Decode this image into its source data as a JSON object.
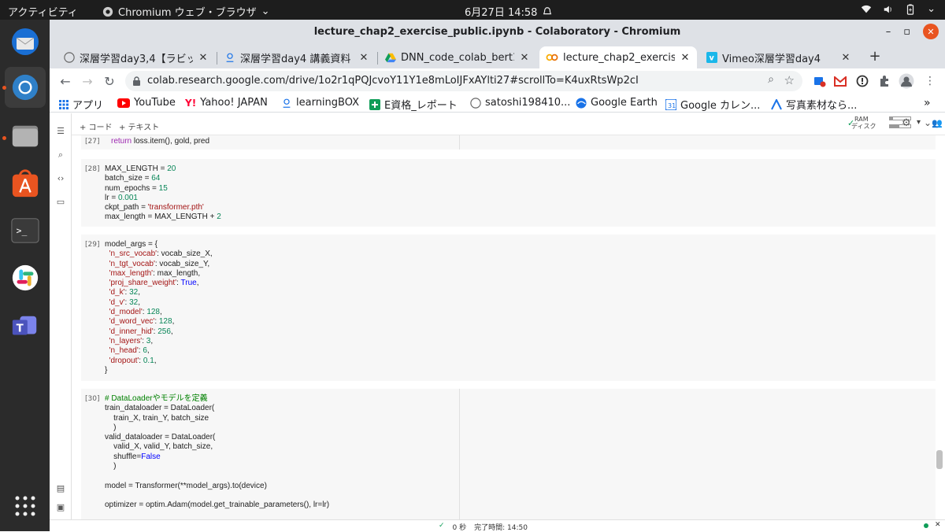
{
  "topbar": {
    "activities": "アクティビティ",
    "app_name": "Chromium ウェブ・ブラウザ",
    "datetime": "6月27日  14:58"
  },
  "dock": {
    "items": [
      "thunderbird",
      "chromium",
      "files",
      "software",
      "terminal",
      "slack",
      "teams",
      "app-grid"
    ]
  },
  "window": {
    "title": "lecture_chap2_exercise_public.ipynb - Colaboratory - Chromium"
  },
  "tabs": [
    {
      "label": "深層学習day3,4【ラビッ",
      "active": false
    },
    {
      "label": "深層学習day4 講義資料",
      "active": false
    },
    {
      "label": "DNN_code_colab_bert1b",
      "active": false
    },
    {
      "label": "lecture_chap2_exercise_",
      "active": true
    },
    {
      "label": "Vimeo深層学習day4",
      "active": false
    }
  ],
  "address_bar": {
    "url": "colab.research.google.com/drive/1o2r1qPQJcvoY11Y1e8mLoIJFxAYlti27#scrollTo=K4uxRtsWp2cI"
  },
  "bookmarks": [
    {
      "label": "アプリ",
      "icon": "apps-grid-icon"
    },
    {
      "label": "YouTube",
      "icon": "youtube-icon"
    },
    {
      "label": "Yahoo! JAPAN",
      "icon": "yahoo-icon"
    },
    {
      "label": "learningBOX",
      "icon": "learningbox-icon"
    },
    {
      "label": "E資格_レポート",
      "icon": "plus-icon"
    },
    {
      "label": "satoshi198410...",
      "icon": "github-icon"
    },
    {
      "label": "Google Earth",
      "icon": "earth-icon"
    },
    {
      "label": "Google カレン...",
      "icon": "calendar-icon"
    },
    {
      "label": "写真素材なら...",
      "icon": "photo-icon"
    }
  ],
  "colab": {
    "add_code": "+ コード",
    "add_text": "+ テキスト",
    "ram_label": "RAM",
    "disk_label": "ディスク",
    "status_time": "0 秒",
    "completed": "完了時間: 14:50"
  },
  "cells": [
    {
      "num": "[27]",
      "line": "return loss.item(), gold, pred"
    },
    {
      "num": "[28]"
    },
    {
      "num": "[29]"
    },
    {
      "num": "[30]"
    }
  ]
}
